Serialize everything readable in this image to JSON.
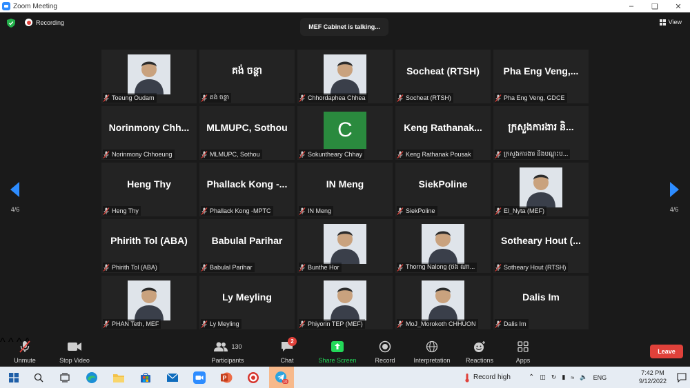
{
  "window": {
    "title": "Zoom Meeting"
  },
  "topbar": {
    "recording_label": "Recording",
    "talking_label": "MEF Cabinet is talking...",
    "view_label": "View"
  },
  "pager": {
    "left_label": "4/6",
    "right_label": "4/6"
  },
  "tiles": [
    {
      "display": "",
      "caption": "Toeung Oudam",
      "photo": true
    },
    {
      "display": "គង់ ចន្ថា",
      "caption": "គង់ ចន្ថា"
    },
    {
      "display": "",
      "caption": "Chhordaphea Chhea",
      "photo": true
    },
    {
      "display": "Socheat (RTSH)",
      "caption": "Socheat (RTSH)"
    },
    {
      "display": "Pha Eng Veng,...",
      "caption": "Pha Eng Veng, GDCE"
    },
    {
      "display": "Norinmony Chh...",
      "caption": "Norinmony Chhoeung"
    },
    {
      "display": "MLMUPC, Sothou",
      "caption": "MLMUPC, Sothou"
    },
    {
      "display": "",
      "caption": "Sokuntheary Chhay",
      "avatar": "C"
    },
    {
      "display": "Keng Rathanak...",
      "caption": "Keng Rathanak Pousak"
    },
    {
      "display": "ក្រសួងការងារ និ...",
      "caption": "ក្រសួងការងារ និងបណ្តុះប..."
    },
    {
      "display": "Heng Thy",
      "caption": "Heng Thy"
    },
    {
      "display": "Phallack Kong -...",
      "caption": "Phallack Kong -MPTC"
    },
    {
      "display": "IN Meng",
      "caption": "IN Meng"
    },
    {
      "display": "SiekPoline",
      "caption": "SiekPoline"
    },
    {
      "display": "",
      "caption": "El_Nyta (MEF)",
      "photo": true
    },
    {
      "display": "Phirith Tol (ABA)",
      "caption": "Phirith Tol (ABA)"
    },
    {
      "display": "Babulal Parihar",
      "caption": "Babulal Parihar"
    },
    {
      "display": "",
      "caption": "Bunthe Hor",
      "photo": true
    },
    {
      "display": "",
      "caption": "Thorng Nalong (ថង ណា...",
      "photo": true
    },
    {
      "display": "Sotheary Hout (...",
      "caption": "Sotheary Hout (RTSH)"
    },
    {
      "display": "",
      "caption": "PHAN Teth, MEF",
      "photo": true
    },
    {
      "display": "Ly Meyling",
      "caption": "Ly Meyling"
    },
    {
      "display": "",
      "caption": "Phiyorin TEP (MEF)",
      "photo": true
    },
    {
      "display": "",
      "caption": "MoJ_Morokoth CHHUON",
      "photo": true
    },
    {
      "display": "Dalis Im",
      "caption": "Dalis Im"
    }
  ],
  "controls": {
    "unmute": "Unmute",
    "stop_video": "Stop Video",
    "participants": "Participants",
    "participants_count": "130",
    "chat": "Chat",
    "chat_badge": "2",
    "share_screen": "Share Screen",
    "record": "Record",
    "interpretation": "Interpretation",
    "reactions": "Reactions",
    "apps": "Apps",
    "leave": "Leave"
  },
  "taskbar": {
    "record_high": "Record high",
    "language": "ENG",
    "time": "7:42 PM",
    "date": "9/12/2022",
    "telegram_badge": "10"
  },
  "colors": {
    "share_green": "#23d959",
    "leave_red": "#e0413a",
    "tile_bg": "#232323"
  }
}
